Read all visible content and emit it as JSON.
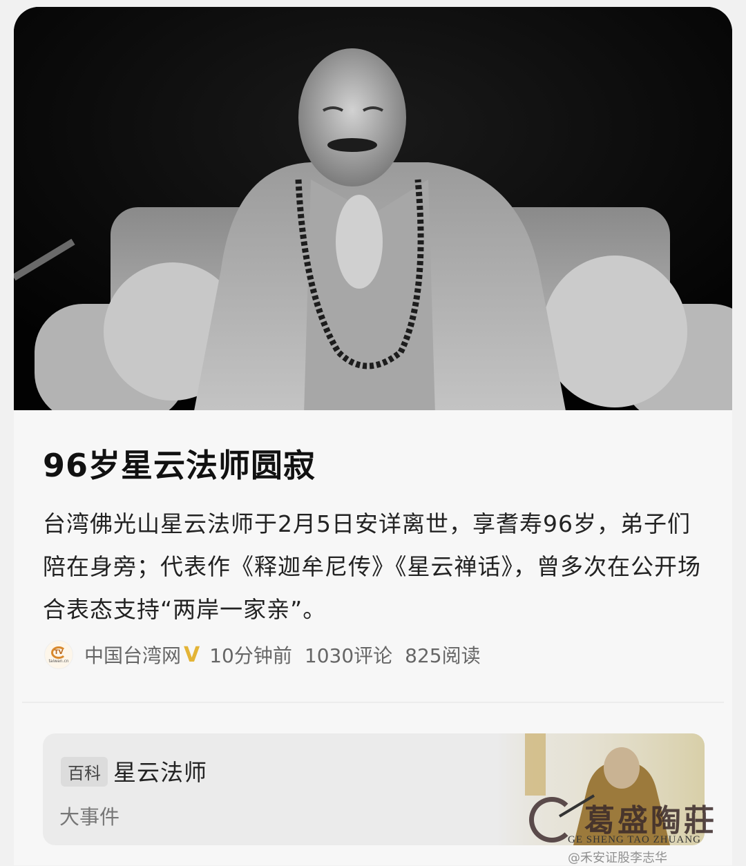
{
  "article": {
    "title": "96岁星云法师圆寂",
    "summary": "台湾佛光山星云法师于2月5日安详离世，享耆寿96岁，弟子们陪在身旁；代表作《释迦牟尼传》《星云禅话》，曾多次在公开场合表态支持“两岸一家亲”。",
    "source": "中国台湾网",
    "verified_mark": "V",
    "time": "10分钟前",
    "comments": "1030评论",
    "reads": "825阅读",
    "source_logo_text": "taiwan.cn",
    "hero_image": "monk-seated-on-sofa-photo"
  },
  "wiki_card": {
    "tag": "百科",
    "name": "星云法师",
    "subtitle": "大事件",
    "thumbnail": "monk-at-lectern-photo"
  },
  "watermark": {
    "brand": "葛盛陶莊",
    "pinyin": "GE SHENG TAO ZHUANG",
    "weibo": "@禾安证股李志华"
  },
  "colors": {
    "title": "#111111",
    "verified": "#e3b437",
    "meta": "#666666",
    "card_bg": "#f7f7f7"
  }
}
